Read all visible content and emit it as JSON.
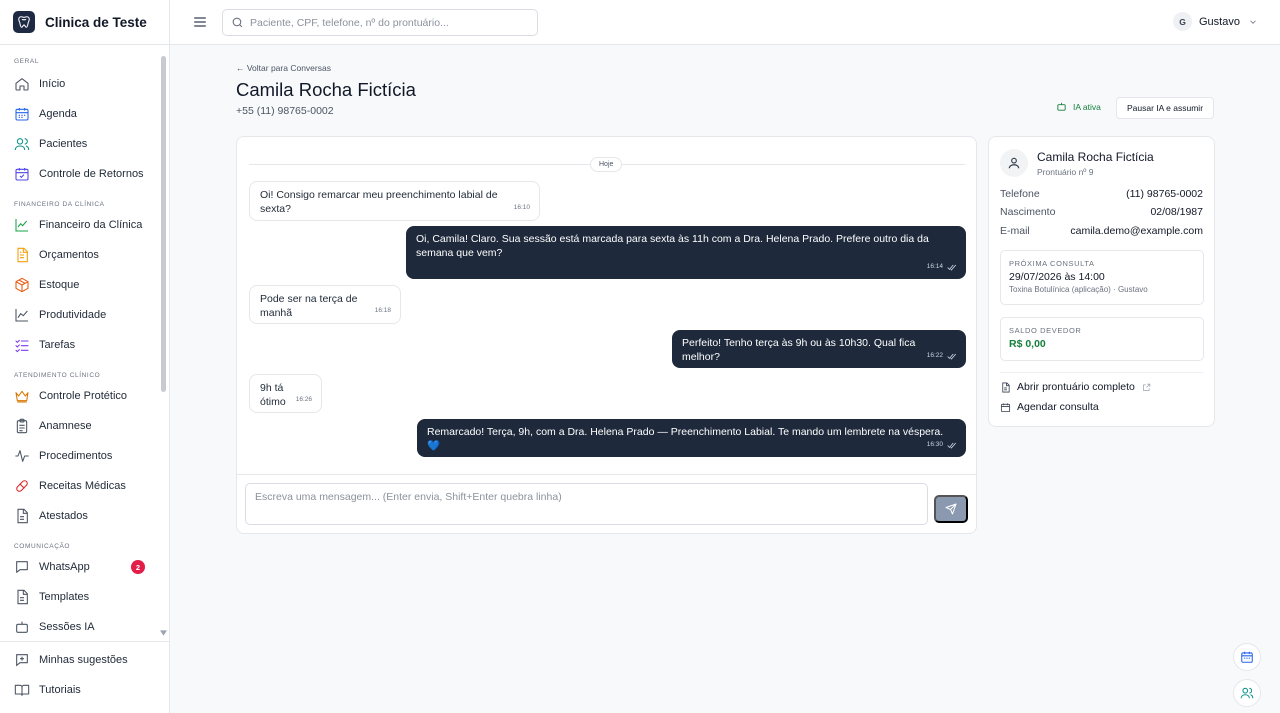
{
  "app": {
    "name": "Clinica de Teste"
  },
  "search": {
    "placeholder": "Paciente, CPF, telefone, nº do prontuário..."
  },
  "user": {
    "initial": "G",
    "name": "Gustavo"
  },
  "sidebar": {
    "sections": [
      {
        "title": "GERAL",
        "items": [
          {
            "label": "Início",
            "icon": "home-icon"
          },
          {
            "label": "Agenda",
            "icon": "calendar-icon"
          },
          {
            "label": "Pacientes",
            "icon": "users-icon"
          },
          {
            "label": "Controle de Retornos",
            "icon": "calendar-check-icon"
          }
        ]
      },
      {
        "title": "FINANCEIRO DA CLÍNICA",
        "items": [
          {
            "label": "Financeiro da Clínica",
            "icon": "trending-up-icon"
          },
          {
            "label": "Orçamentos",
            "icon": "document-icon"
          },
          {
            "label": "Estoque",
            "icon": "package-icon"
          },
          {
            "label": "Produtividade",
            "icon": "line-chart-icon"
          },
          {
            "label": "Tarefas",
            "icon": "checklist-icon"
          }
        ]
      },
      {
        "title": "ATENDIMENTO CLÍNICO",
        "items": [
          {
            "label": "Controle Protético",
            "icon": "crown-icon"
          },
          {
            "label": "Anamnese",
            "icon": "clipboard-icon"
          },
          {
            "label": "Procedimentos",
            "icon": "activity-icon"
          },
          {
            "label": "Receitas Médicas",
            "icon": "pill-icon"
          },
          {
            "label": "Atestados",
            "icon": "file-text-icon"
          }
        ]
      },
      {
        "title": "COMUNICAÇÃO",
        "items": [
          {
            "label": "WhatsApp",
            "icon": "chat-icon",
            "badge": "2"
          },
          {
            "label": "Templates",
            "icon": "file-icon"
          },
          {
            "label": "Sessões IA",
            "icon": "bot-icon"
          }
        ]
      }
    ],
    "bottom": [
      {
        "label": "Minhas sugestões",
        "icon": "suggestion-icon"
      },
      {
        "label": "Tutoriais",
        "icon": "book-icon"
      }
    ]
  },
  "conversation": {
    "back_label": "← Voltar para Conversas",
    "patient_name": "Camila Rocha Fictícia",
    "patient_phone": "+55 (11) 98765-0002",
    "ia_status": "IA ativa",
    "pause_label": "Pausar IA e assumir",
    "day_label": "Hoje",
    "messages": [
      {
        "dir": "in",
        "text": "Oi! Consigo remarcar meu preenchimento labial de sexta?",
        "time": "16:10"
      },
      {
        "dir": "out",
        "text": "Oi, Camila! Claro. Sua sessão está marcada para sexta às 11h com a Dra. Helena Prado. Prefere outro dia da semana que vem?",
        "time": "16:14"
      },
      {
        "dir": "in",
        "text": "Pode ser na terça de manhã",
        "time": "16:18"
      },
      {
        "dir": "out",
        "text": "Perfeito! Tenho terça às 9h ou às 10h30. Qual fica melhor?",
        "time": "16:22"
      },
      {
        "dir": "in",
        "text": "9h tá ótimo",
        "time": "16:26"
      },
      {
        "dir": "out",
        "text": "Remarcado! Terça, 9h, com a Dra. Helena Prado — Preenchimento Labial. Te mando um lembrete na véspera. 💙",
        "time": "16:30"
      }
    ],
    "composer_placeholder": "Escreva uma mensagem... (Enter envia, Shift+Enter quebra linha)"
  },
  "patient": {
    "name": "Camila Rocha Fictícia",
    "record": "Prontuário nº 9",
    "fields": [
      {
        "key": "Telefone",
        "value": "(11) 98765-0002"
      },
      {
        "key": "Nascimento",
        "value": "02/08/1987"
      },
      {
        "key": "E-mail",
        "value": "camila.demo@example.com"
      }
    ],
    "next_appointment": {
      "label": "PRÓXIMA CONSULTA",
      "datetime": "29/07/2026 às 14:00",
      "detail": "Toxina Botulínica (aplicação) · Gustavo"
    },
    "balance": {
      "label": "SALDO DEVEDOR",
      "value": "R$ 0,00"
    },
    "open_record_label": "Abrir prontuário completo",
    "schedule_label": "Agendar consulta"
  },
  "colors": {
    "primary": "#1e293b",
    "success": "#15803d",
    "badge": "#e11d48"
  }
}
